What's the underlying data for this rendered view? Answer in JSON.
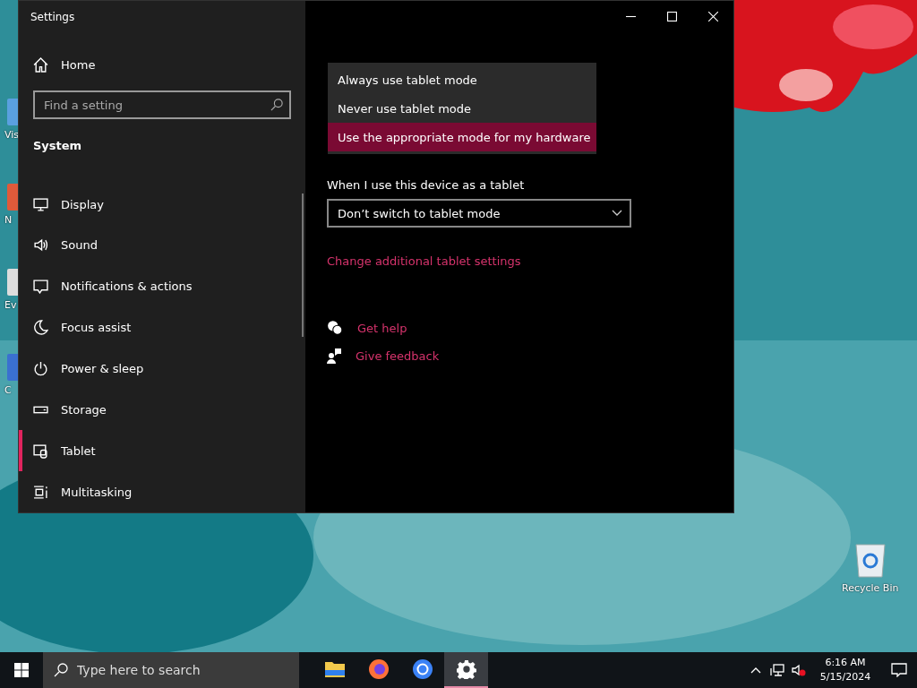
{
  "desktop": {
    "left_icons": [
      {
        "label": "Vis"
      },
      {
        "label": "N"
      },
      {
        "label": "Ev"
      },
      {
        "label": "C"
      }
    ],
    "recycle_bin": {
      "label": "Recycle Bin"
    }
  },
  "window": {
    "title": "Settings",
    "sidebar": {
      "home": "Home",
      "search": {
        "placeholder": "Find a setting"
      },
      "section": "System",
      "items": [
        {
          "kind": "display",
          "label": "Display",
          "selected": false
        },
        {
          "kind": "sound",
          "label": "Sound",
          "selected": false
        },
        {
          "kind": "notifications",
          "label": "Notifications & actions",
          "selected": false
        },
        {
          "kind": "focus",
          "label": "Focus assist",
          "selected": false
        },
        {
          "kind": "power",
          "label": "Power & sleep",
          "selected": false
        },
        {
          "kind": "storage",
          "label": "Storage",
          "selected": false
        },
        {
          "kind": "tablet",
          "label": "Tablet",
          "selected": true
        },
        {
          "kind": "multitasking",
          "label": "Multitasking",
          "selected": false
        }
      ]
    },
    "content": {
      "dropdown_options": [
        {
          "label": "Always use tablet mode",
          "selected": false
        },
        {
          "label": "Never use tablet mode",
          "selected": false
        },
        {
          "label": "Use the appropriate mode for my hardware",
          "selected": true
        }
      ],
      "field_label": "When I use this device as a tablet",
      "select_value": "Don’t switch to tablet mode",
      "link": "Change additional tablet settings",
      "help_links": [
        {
          "kind": "help",
          "label": "Get help"
        },
        {
          "kind": "feedback",
          "label": "Give feedback"
        }
      ]
    }
  },
  "taskbar": {
    "search": {
      "placeholder": "Type here to search"
    },
    "apps": [
      {
        "kind": "explorer",
        "selected": false
      },
      {
        "kind": "firefox",
        "selected": false
      },
      {
        "kind": "browser",
        "selected": false
      },
      {
        "kind": "settings",
        "selected": true
      }
    ],
    "time": "6:16 AM",
    "date": "5/15/2024"
  }
}
